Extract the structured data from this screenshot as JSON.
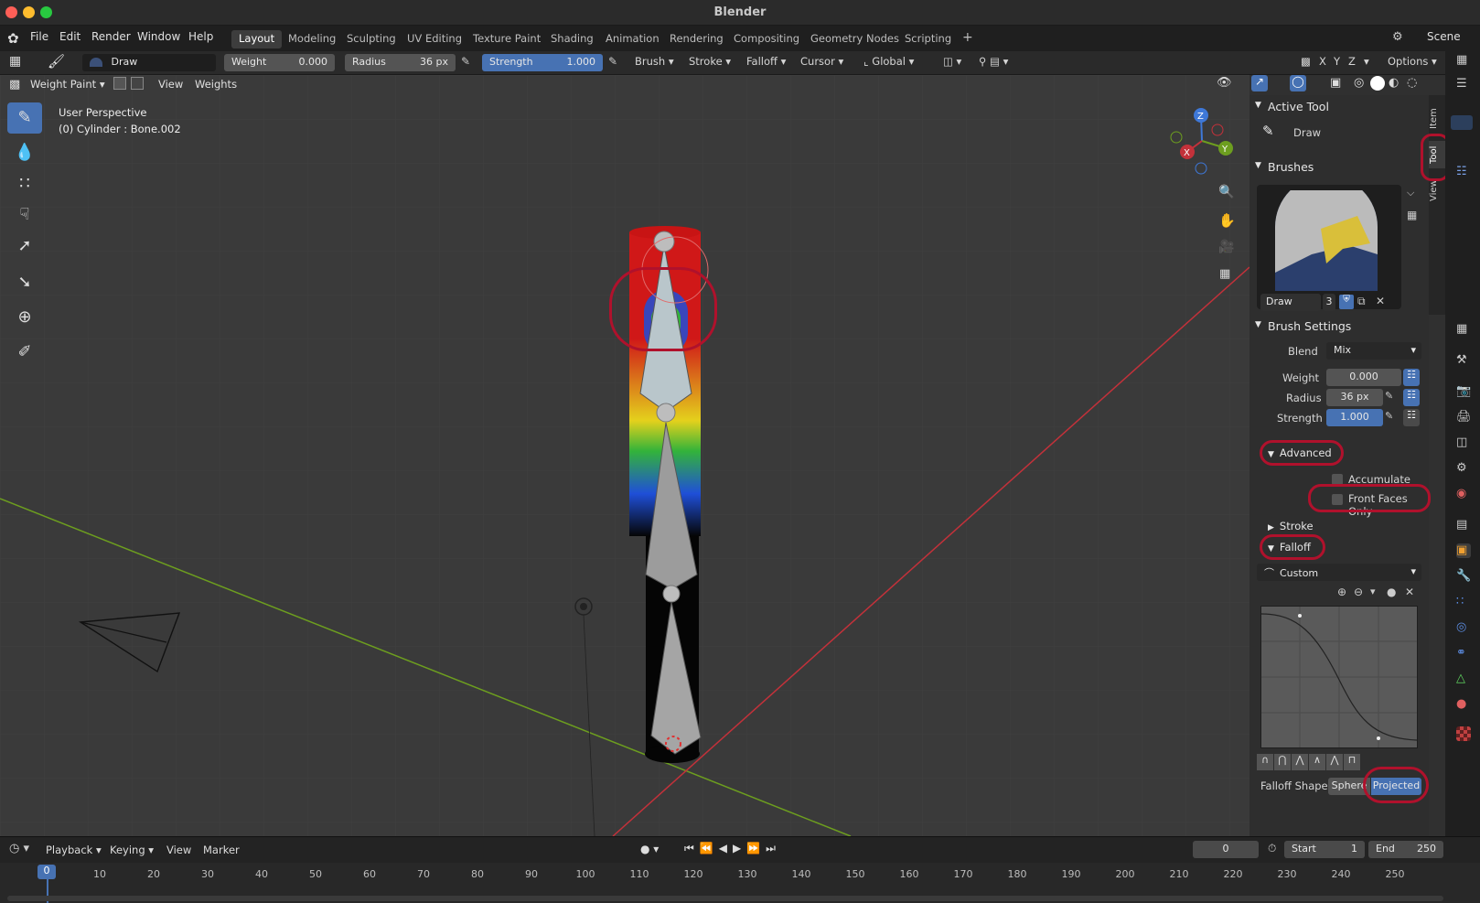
{
  "window": {
    "title": "Blender"
  },
  "menu": [
    "File",
    "Edit",
    "Render",
    "Window",
    "Help"
  ],
  "workspaces": [
    {
      "label": "Layout",
      "active": true
    },
    {
      "label": "Modeling",
      "active": false
    },
    {
      "label": "Sculpting",
      "active": false
    },
    {
      "label": "UV Editing",
      "active": false
    },
    {
      "label": "Texture Paint",
      "active": false
    },
    {
      "label": "Shading",
      "active": false
    },
    {
      "label": "Animation",
      "active": false
    },
    {
      "label": "Rendering",
      "active": false
    },
    {
      "label": "Compositing",
      "active": false
    },
    {
      "label": "Geometry Nodes",
      "active": false
    },
    {
      "label": "Scripting",
      "active": false
    }
  ],
  "add_workspace": "+",
  "scene": "Scene",
  "tool_header": {
    "brush_name": "Draw",
    "weight_label": "Weight",
    "weight_value": "0.000",
    "radius_label": "Radius",
    "radius_value": "36 px",
    "strength_label": "Strength",
    "strength_value": "1.000",
    "brush_menu": "Brush",
    "stroke_menu": "Stroke",
    "falloff_menu": "Falloff",
    "cursor_menu": "Cursor",
    "orientation": "Global",
    "axis_x": "X",
    "axis_y": "Y",
    "axis_z": "Z",
    "options": "Options"
  },
  "editor_header": {
    "mode": "Weight Paint",
    "view": "View",
    "weights": "Weights"
  },
  "viewport": {
    "perspective": "User Perspective",
    "object_info": "(0) Cylinder : Bone.002"
  },
  "gizmo": {
    "x": "X",
    "y": "Y",
    "z": "Z"
  },
  "sidebar_tabs": [
    "Item",
    "Tool",
    "View"
  ],
  "npanel": {
    "active_tool_header": "Active Tool",
    "active_tool_name": "Draw",
    "brushes_header": "Brushes",
    "brush_name": "Draw",
    "brush_users": "3",
    "brush_settings_header": "Brush Settings",
    "blend_label": "Blend",
    "blend_value": "Mix",
    "weight_label": "Weight",
    "weight_value": "0.000",
    "radius_label": "Radius",
    "radius_value": "36 px",
    "strength_label": "Strength",
    "strength_value": "1.000",
    "advanced_header": "Advanced",
    "accumulate": "Accumulate",
    "front_faces_only": "Front Faces Only",
    "stroke_header": "Stroke",
    "falloff_header": "Falloff",
    "falloff_preset": "Custom",
    "falloff_shape_label": "Falloff Shape",
    "falloff_shape_sphere": "Sphere",
    "falloff_shape_projected": "Projected"
  },
  "timeline": {
    "menus": [
      "Playback",
      "Keying",
      "View",
      "Marker"
    ],
    "current_frame": "0",
    "start_label": "Start",
    "start_value": "1",
    "end_label": "End",
    "end_value": "250",
    "frame_cursor": "0",
    "ticks": [
      "10",
      "20",
      "30",
      "40",
      "50",
      "60",
      "70",
      "80",
      "90",
      "100",
      "110",
      "120",
      "130",
      "140",
      "150",
      "160",
      "170",
      "180",
      "190",
      "200",
      "210",
      "220",
      "230",
      "240",
      "250"
    ]
  },
  "colors": {
    "accent": "#4772b3",
    "highlight": "#b0112c",
    "background": "#3a3a3a",
    "x_axis": "#c3313a",
    "y_axis": "#6d9e1f",
    "z_axis": "#3e78d8"
  }
}
